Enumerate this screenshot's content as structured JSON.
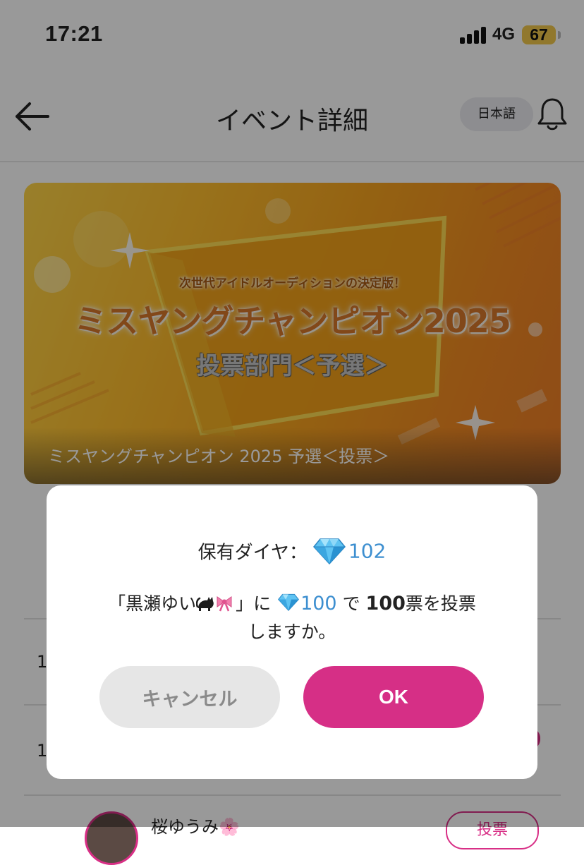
{
  "status_bar": {
    "time": "17:21",
    "network": "4G",
    "battery": "67"
  },
  "nav": {
    "title": "イベント詳細",
    "language_label": "日本語",
    "back_icon": "arrow-left-icon",
    "bell_icon": "bell-icon"
  },
  "banner": {
    "subtitle": "次世代アイドルオーディションの決定版！",
    "headline": "ミスヤングチャンピオン2025",
    "division": "投票部門＜予選＞",
    "caption": "ミスヤングチャンピオン 2025 予選＜投票＞"
  },
  "list": {
    "rows": [
      {
        "rank": "1"
      },
      {
        "rank": "1"
      },
      {
        "name": "桜ゆうみ🌸",
        "vote_label": "投票"
      }
    ]
  },
  "dialog": {
    "balance_label": "保有ダイヤ：",
    "balance_value": "102",
    "confirm_open_quote": "「黒瀬ゆい",
    "confirm_emoji": "🐈‍⬛🎀",
    "confirm_close_quote": "」に",
    "cost_amount": "100",
    "confirm_de": "で",
    "vote_count": "100",
    "confirm_tail": "票を投票",
    "confirm_line2": "しますか。",
    "cancel_label": "キャンセル",
    "ok_label": "OK"
  },
  "colors": {
    "accent_pink": "#d62f86",
    "diamond_blue": "#3d8fd0",
    "battery_yellow": "#f2c94c"
  }
}
